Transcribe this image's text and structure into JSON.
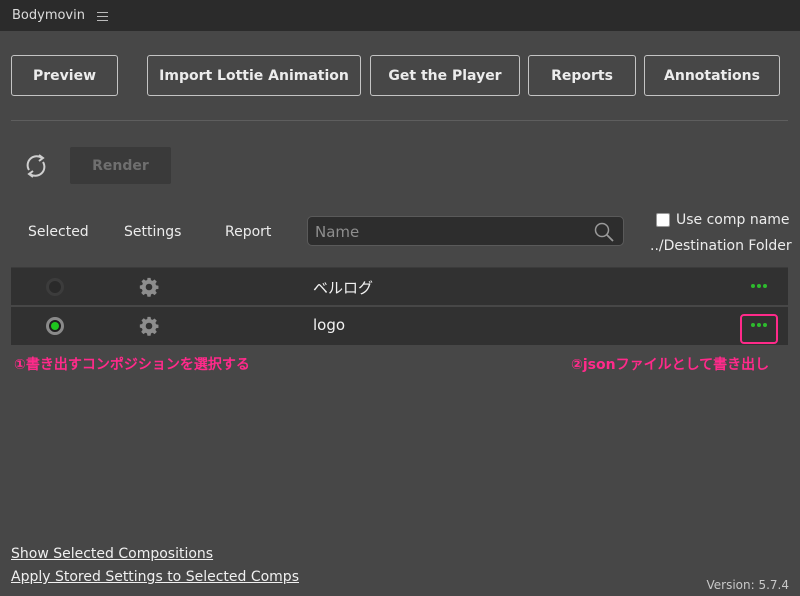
{
  "titlebar": {
    "title": "Bodymovin"
  },
  "toolbar": {
    "preview": "Preview",
    "import_lottie": "Import Lottie Animation",
    "get_player": "Get the Player",
    "reports": "Reports",
    "annotations": "Annotations"
  },
  "render": {
    "label": "Render"
  },
  "columns": {
    "selected": "Selected",
    "settings": "Settings",
    "report": "Report"
  },
  "search": {
    "placeholder": "Name"
  },
  "options": {
    "use_comp_name": "Use comp name",
    "destination_folder": "../Destination Folder"
  },
  "compositions": [
    {
      "name": "ベルログ",
      "selected": false
    },
    {
      "name": "logo",
      "selected": true
    }
  ],
  "annotations_overlay": {
    "left": "①書き出すコンポジションを選択する",
    "right": "②jsonファイルとして書き出し"
  },
  "footer": {
    "show_selected": "Show Selected Compositions",
    "apply_stored": "Apply Stored Settings to Selected Comps",
    "version": "Version: 5.7.4"
  },
  "colors": {
    "accent_green": "#1ec51e",
    "annotation_pink": "#ff2a8a"
  },
  "icons": [
    "menu-icon",
    "refresh-icon",
    "search-icon",
    "gear-icon",
    "more-icon"
  ]
}
